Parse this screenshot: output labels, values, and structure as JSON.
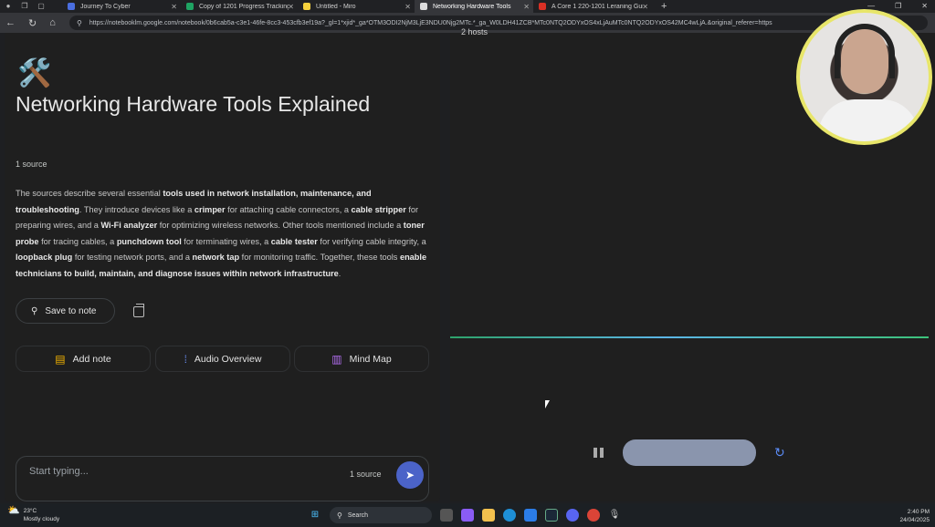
{
  "browser": {
    "tabs": [
      {
        "label": "Journey To Cyber",
        "color": "#4a6ee0"
      },
      {
        "label": "Copy of 1201 Progress Tracking S",
        "color": "#1fa463"
      },
      {
        "label": "Untitled - Miro",
        "color": "#f5d13d"
      },
      {
        "label": "Networking Hardware Tools",
        "color": "#dddddd"
      },
      {
        "label": "A Core 1 220-1201 Leraning Guid",
        "color": "#d93025"
      }
    ],
    "new_tab": "+",
    "url": "https://notebooklm.google.com/notebook/0b6cab5a-c3e1-46fe-8cc3-453cfb3ef19a?_gl=1*xjid*_ga*OTM3ODI2NjM3LjE3NDU0Njg2MTc.*_ga_W0LDH41ZCB*MTc0NTQ2ODYxOS4xLjAuMTc0NTQ2ODYxOS42MC4wLjA.&original_referer=https"
  },
  "notebook": {
    "emoji": "🛠️",
    "title": "Networking Hardware Tools Explained",
    "source_count": "1 source",
    "summary": [
      {
        "t": "The sources describe several essential ",
        "b": false
      },
      {
        "t": "tools used in network installation, maintenance, and troubleshooting",
        "b": true
      },
      {
        "t": ". They introduce devices like a ",
        "b": false
      },
      {
        "t": "crimper",
        "b": true
      },
      {
        "t": " for attaching cable connectors, a ",
        "b": false
      },
      {
        "t": "cable stripper",
        "b": true
      },
      {
        "t": " for preparing wires, and a ",
        "b": false
      },
      {
        "t": "Wi-Fi analyzer",
        "b": true
      },
      {
        "t": " for optimizing wireless networks. Other tools mentioned include a ",
        "b": false
      },
      {
        "t": "toner probe",
        "b": true
      },
      {
        "t": " for tracing cables, a ",
        "b": false
      },
      {
        "t": "punchdown tool",
        "b": true
      },
      {
        "t": " for terminating wires, a ",
        "b": false
      },
      {
        "t": "cable tester",
        "b": true
      },
      {
        "t": " for verifying cable integrity, a ",
        "b": false
      },
      {
        "t": "loopback plug",
        "b": true
      },
      {
        "t": " for testing network ports, and a ",
        "b": false
      },
      {
        "t": "network tap",
        "b": true
      },
      {
        "t": " for monitoring traffic. Together, these tools ",
        "b": false
      },
      {
        "t": "enable technicians to build, maintain, and diagnose issues within network infrastructure",
        "b": true
      },
      {
        "t": ".",
        "b": false
      }
    ],
    "save_label": "Save to note",
    "actions": {
      "add_note": "Add note",
      "audio_overview": "Audio Overview",
      "mind_map": "Mind Map"
    },
    "chat": {
      "placeholder": "Start typing...",
      "source_count": "1 source"
    }
  },
  "audio_panel": {
    "hosts": "2 hosts"
  },
  "taskbar": {
    "temp": "23°C",
    "condition": "Mostly cloudy",
    "search": "Search",
    "time": "2:40 PM",
    "date": "24/04/2025"
  }
}
